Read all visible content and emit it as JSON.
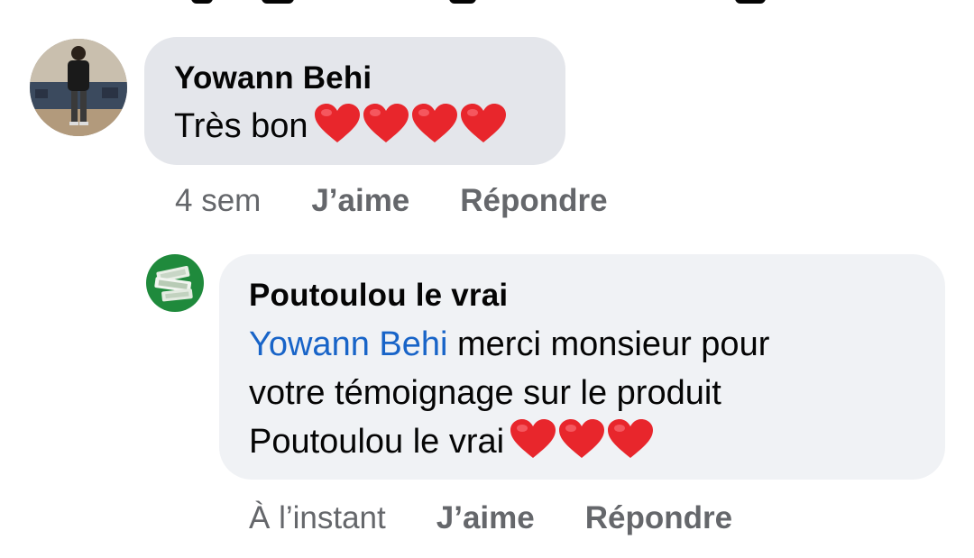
{
  "comments": [
    {
      "author": "Yowann Behi",
      "text": "Très bon",
      "emoji": "heart",
      "emoji_count": 4,
      "time": "4 sem",
      "like_label": "J’aime",
      "reply_label": "Répondre"
    }
  ],
  "replies": [
    {
      "author": "Poutoulou le vrai",
      "mention": "Yowann Behi",
      "line1_rest": " merci monsieur pour",
      "line2": "votre témoignage sur le produit",
      "line3": "Poutoulou le vrai",
      "emoji": "heart",
      "emoji_count": 3,
      "time": "À l’instant",
      "like_label": "J’aime",
      "reply_label": "Répondre"
    }
  ],
  "colors": {
    "heart": "#e8262c",
    "mention": "#1864c8",
    "bubble": "#f0f2f5",
    "meta_text": "#65676b",
    "avatar_green": "#1f8a3c"
  }
}
